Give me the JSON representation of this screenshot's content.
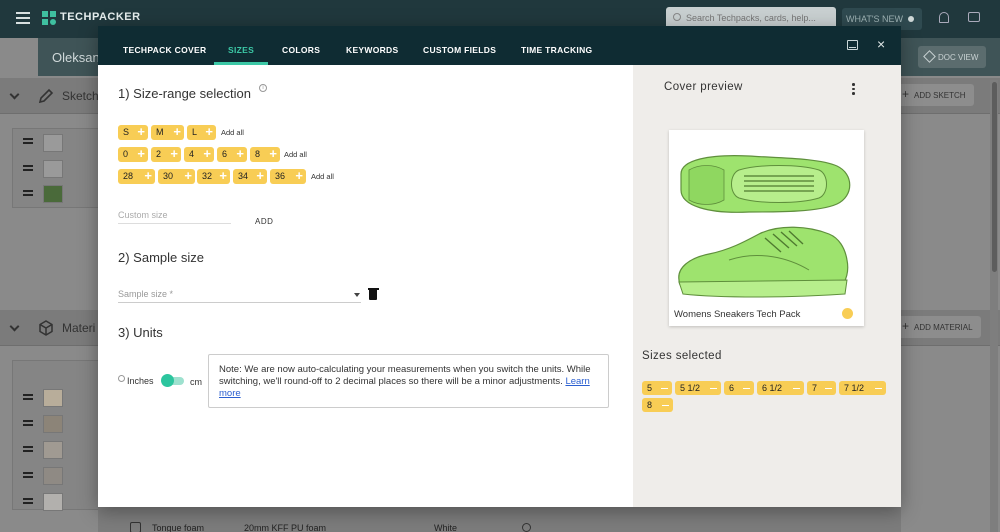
{
  "app": {
    "logo": "TECHPACKER",
    "search_placeholder": "Search Techpacks, cards, help...",
    "whats_new": "WHAT'S NEW",
    "doc_view": "DOC VIEW",
    "user_name": "Oleksan"
  },
  "background": {
    "sketch_section": "Sketch",
    "add_sketch": "ADD SKETCH",
    "materials_section": "Materi",
    "add_material": "ADD MATERIAL",
    "bottom_row": {
      "name": "Tongue foam",
      "description": "20mm KFF PU foam",
      "color": "White"
    }
  },
  "modal": {
    "tabs": [
      "TECHPACK COVER",
      "SIZES",
      "COLORS",
      "KEYWORDS",
      "CUSTOM FIELDS",
      "TIME TRACKING"
    ],
    "active_tab": "SIZES",
    "close_label": "×",
    "size_range": {
      "title": "1) Size-range selection",
      "rows": [
        {
          "sizes": [
            "S",
            "M",
            "L"
          ],
          "add_all": "Add all"
        },
        {
          "sizes": [
            "0",
            "2",
            "4",
            "6",
            "8"
          ],
          "add_all": "Add all"
        },
        {
          "sizes": [
            "28",
            "30",
            "32",
            "34",
            "36"
          ],
          "add_all": "Add all"
        }
      ],
      "custom_placeholder": "Custom size",
      "add_button": "ADD"
    },
    "sample_size": {
      "title": "2) Sample size",
      "placeholder": "Sample size *"
    },
    "units": {
      "title": "3) Units",
      "inches_label": "Inches",
      "cm_label": "cm",
      "note": "Note: We are now auto-calculating your measurements when you switch the units. While switching, we'll round-off to 2 decimal places so there will be a minor adjustments.",
      "learn_more": "Learn more"
    },
    "cover_preview": {
      "title": "Cover preview",
      "card_name": "Womens Sneakers Tech Pack",
      "sizes_selected_title": "Sizes selected",
      "sizes_selected": [
        "5",
        "5 1/2",
        "6",
        "6 1/2",
        "7",
        "7 1/2",
        "8"
      ]
    }
  },
  "colors": {
    "accent": "#3cc8a6",
    "chip": "#f8cd55",
    "header": "#0f2c33",
    "shoe": "#9ee36e"
  }
}
